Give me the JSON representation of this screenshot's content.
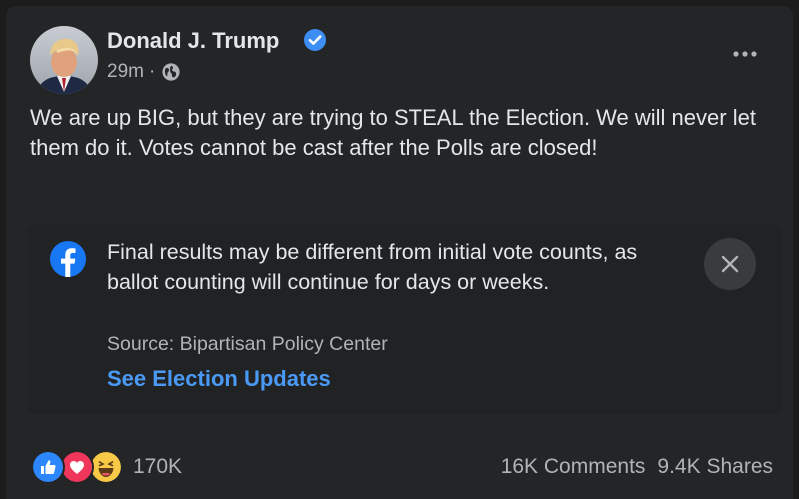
{
  "post": {
    "author_name": "Donald J. Trump",
    "timestamp": "29m",
    "separator": "·",
    "privacy_icon": "globe-icon",
    "verified_icon": "verified-badge-icon",
    "more_icon": "more-options-icon",
    "text": "We are up BIG, but they are trying to STEAL the Election. We will never let them do it. Votes cannot be cast after the Polls are closed!"
  },
  "notice": {
    "icon": "facebook-logo-icon",
    "body": "Final results may be different from initial vote counts, as ballot counting will continue for days or weeks.",
    "source": "Source: Bipartisan Policy Center",
    "link_label": "See Election Updates",
    "close_icon": "close-icon"
  },
  "footer": {
    "reactions": [
      "like-reaction-icon",
      "love-reaction-icon",
      "haha-reaction-icon"
    ],
    "reaction_count": "170K",
    "comments": "16K Comments",
    "shares": "9.4K Shares"
  },
  "colors": {
    "background": "#242526",
    "text_primary": "#e4e6eb",
    "text_secondary": "#b0b3b8",
    "link": "#4a9af5",
    "verified": "#3c8ef3",
    "facebook_blue": "#1877f2"
  }
}
